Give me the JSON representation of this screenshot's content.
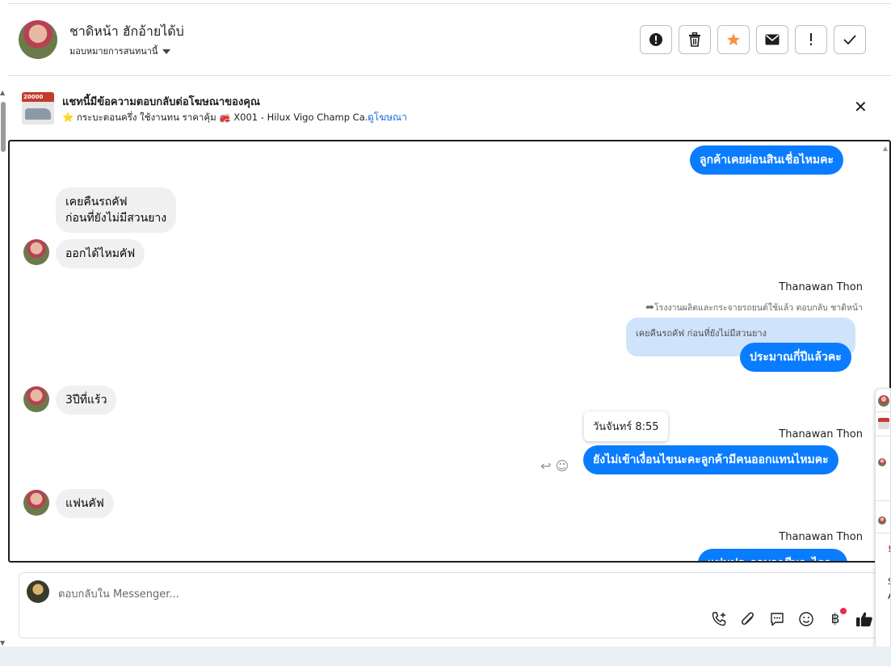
{
  "header": {
    "contact_name": "ชาดิหน้า ฮักอ้ายได้บ่",
    "assign_label": "มอบหมายการสนทนานี้",
    "actions": [
      {
        "icon": "alert-circle-icon",
        "name": "mark-spam-button"
      },
      {
        "icon": "trash-icon",
        "name": "delete-button"
      },
      {
        "icon": "star-icon",
        "name": "star-button"
      },
      {
        "icon": "envelope-icon",
        "name": "mark-unread-button"
      },
      {
        "icon": "exclamation-icon",
        "name": "follow-up-button"
      },
      {
        "icon": "check-icon",
        "name": "mark-done-button"
      }
    ],
    "star_color": "#f7923b"
  },
  "ad": {
    "title": "แชทนี้มีข้อความตอบกลับต่อโฆษณาของคุณ",
    "desc": "⭐ กระบะตอนครึ่ง ใช้งานทน ราคาคุ้ม 🚒 X001 - Hilux Vigo Champ Ca...",
    "link": "ดูโฆษณา",
    "thumb_price": "20000"
  },
  "thread": {
    "messages": [
      {
        "text": "ลูกค้าเคยผ่อนสินเชื่อไหมคะ"
      },
      {
        "line1": "เคยคืนรถคัฟ",
        "line2": "ก่อนที่ยังไม่มีสวนยาง"
      },
      {
        "text": "ออกได้ไหมคัฟ"
      },
      {
        "sender": "Thanawan Thon",
        "reply_note": "โรงงานผลิตและกระจายรถยนต์ใช้แล้ว ตอบกลับ ชาดิหน้า",
        "quoted": "เคยคืนรถคัฟ ก่อนที่ยังไม่มีสวนยาง",
        "text": "ประมาณกี่ปีแล้วคะ"
      },
      {
        "text": "3ปีที่แร้ว"
      },
      {
        "sender": "Thanawan Thon",
        "tooltip": "วันจันทร์ 8:55",
        "text": "ยังไม่เข้าเงื่อนไขนะคะลูกค้ามีคนออกแทนไหมคะ"
      },
      {
        "text": "แฟนคัฟ"
      },
      {
        "sender": "Thanawan Thon",
        "text": "แฟนประกอบอาชีพอะไรคะ"
      }
    ],
    "outgoing_color": "#0a7cff",
    "incoming_color": "#f0f0f0"
  },
  "composer": {
    "placeholder": "ตอบกลับใน Messenger...",
    "tools": [
      "add-call-icon",
      "paperclip-icon",
      "saved-reply-icon",
      "emoji-icon",
      "baht-payment-icon",
      "thumbs-up-icon"
    ],
    "baht_symbol": "฿"
  },
  "side_panel": {
    "letter_a": "A"
  }
}
